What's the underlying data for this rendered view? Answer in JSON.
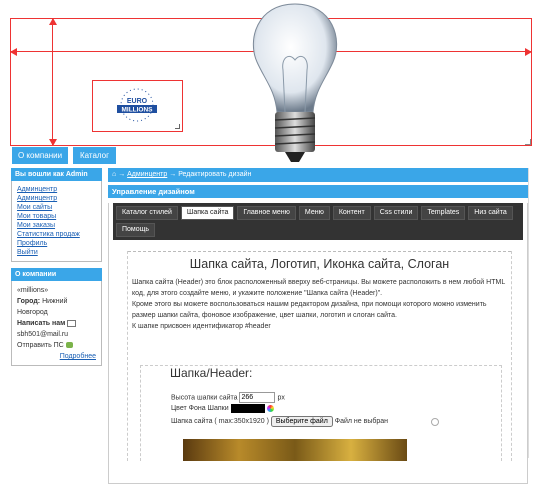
{
  "colors": {
    "accent": "#3aa6e8",
    "guide": "#ee3333",
    "panel_dark": "#333333"
  },
  "top_nav": {
    "items": [
      "О компании",
      "Каталог"
    ]
  },
  "sidebar": {
    "admin_title": "Вы вошли как Admin",
    "admin_links": [
      "Админцентр",
      "Админцентр",
      "Мои сайты",
      "Мои товары",
      "Мои заказы",
      "Статистика продаж",
      "Профиль",
      "Выйти"
    ],
    "company_title": "О компании",
    "company_name": "«millions»",
    "city_label": "Город:",
    "city_value": "Нижний Новгород",
    "write_label": "Написать нам",
    "email": "sbh501@mail.ru",
    "send_label": "Отправить ПС",
    "more_link": "Подробнее"
  },
  "breadcrumb": {
    "home_icon": "home-icon",
    "sep1": "→",
    "link": "Админцентр",
    "sep2": "→",
    "current": "Редактировать дизайн"
  },
  "panel": {
    "title": "Управление дизайном"
  },
  "tabs": [
    "Каталог стилей",
    "Шапка сайта",
    "Главное меню",
    "Меню",
    "Контент",
    "Css стили",
    "Templates",
    "Низ сайта",
    "Помощь"
  ],
  "active_tab": "Шапка сайта",
  "content": {
    "heading": "Шапка сайта, Логотип, Иконка сайта, Слоган",
    "paragraph1": "Шапка сайта (Header) это блок расположенный вверху веб-страницы. Вы можете расположить в нем любой HTML код, для этого создайте меню, и укажите положение \"Шапка сайта (Header)\".",
    "paragraph2": "Кроме этого вы можете воспользоваться нашим редактором дизайна, при помощи которого можно изменить размер шапки сайта, фоновое изображение, цвет шапки, логотип и слоган сайта.",
    "paragraph3": "К шапке присвоен идентификатор #header",
    "section_title": "Шапка/Header:",
    "height_label": "Высота шапки сайта",
    "height_value": "266",
    "height_unit": "px",
    "bg_color_label": "Цвет Фона Шапки",
    "bg_color_value": "#000000",
    "image_label": "Шапка сайта ( max:350x1920 )",
    "file_button": "Выберите файл",
    "file_status": "Файл не выбран"
  },
  "logo": {
    "line1": "EURO",
    "line2": "MILLIONS"
  }
}
